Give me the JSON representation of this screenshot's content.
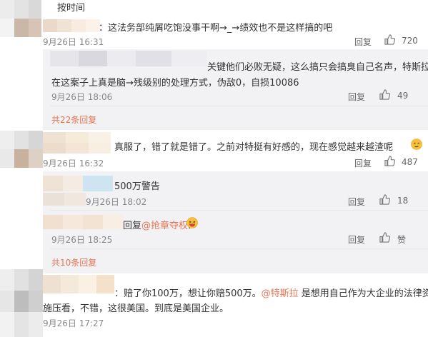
{
  "sort_label": "按时间",
  "actions": {
    "reply": "回复"
  },
  "comments": [
    {
      "text": "：这法务部纯屑吃饱没事干啊→_→绩效也不是这样搞的吧",
      "time": "9月26日 16:31",
      "likes": "720",
      "replies": [
        {
          "line1": "关键他们必败无疑，这么搞只会搞臭自己名声，特斯拉",
          "line2": "在这案子上真是脑→残级别的处理方式，伪敌0，自损10086",
          "time": "9月26日 18:06",
          "likes": "49"
        }
      ],
      "more": "共22条回复"
    },
    {
      "text": "真服了，错了就是错了。之前对特挺有好感的，现在感觉越来越渣呢",
      "time": "9月26日 16:32",
      "likes": "487",
      "replies": [
        {
          "text": "500万警告",
          "time": "9月26日 18:02",
          "likes": "18"
        },
        {
          "prefix": "回复",
          "mention": "@抢章夺权",
          "suffix": ":",
          "time": "9月26日 18:25",
          "likes": "赞"
        }
      ],
      "more": "共10条回复"
    },
    {
      "line1_a": "：赔了你100万，想让你赔500万。",
      "line1_mention": "@特斯拉",
      "line1_b": "是想用自己作为大企业的法律资源",
      "line2": "施压看，不错，这很美国。到底是美国企业。",
      "time": "9月26日 17:27"
    }
  ]
}
